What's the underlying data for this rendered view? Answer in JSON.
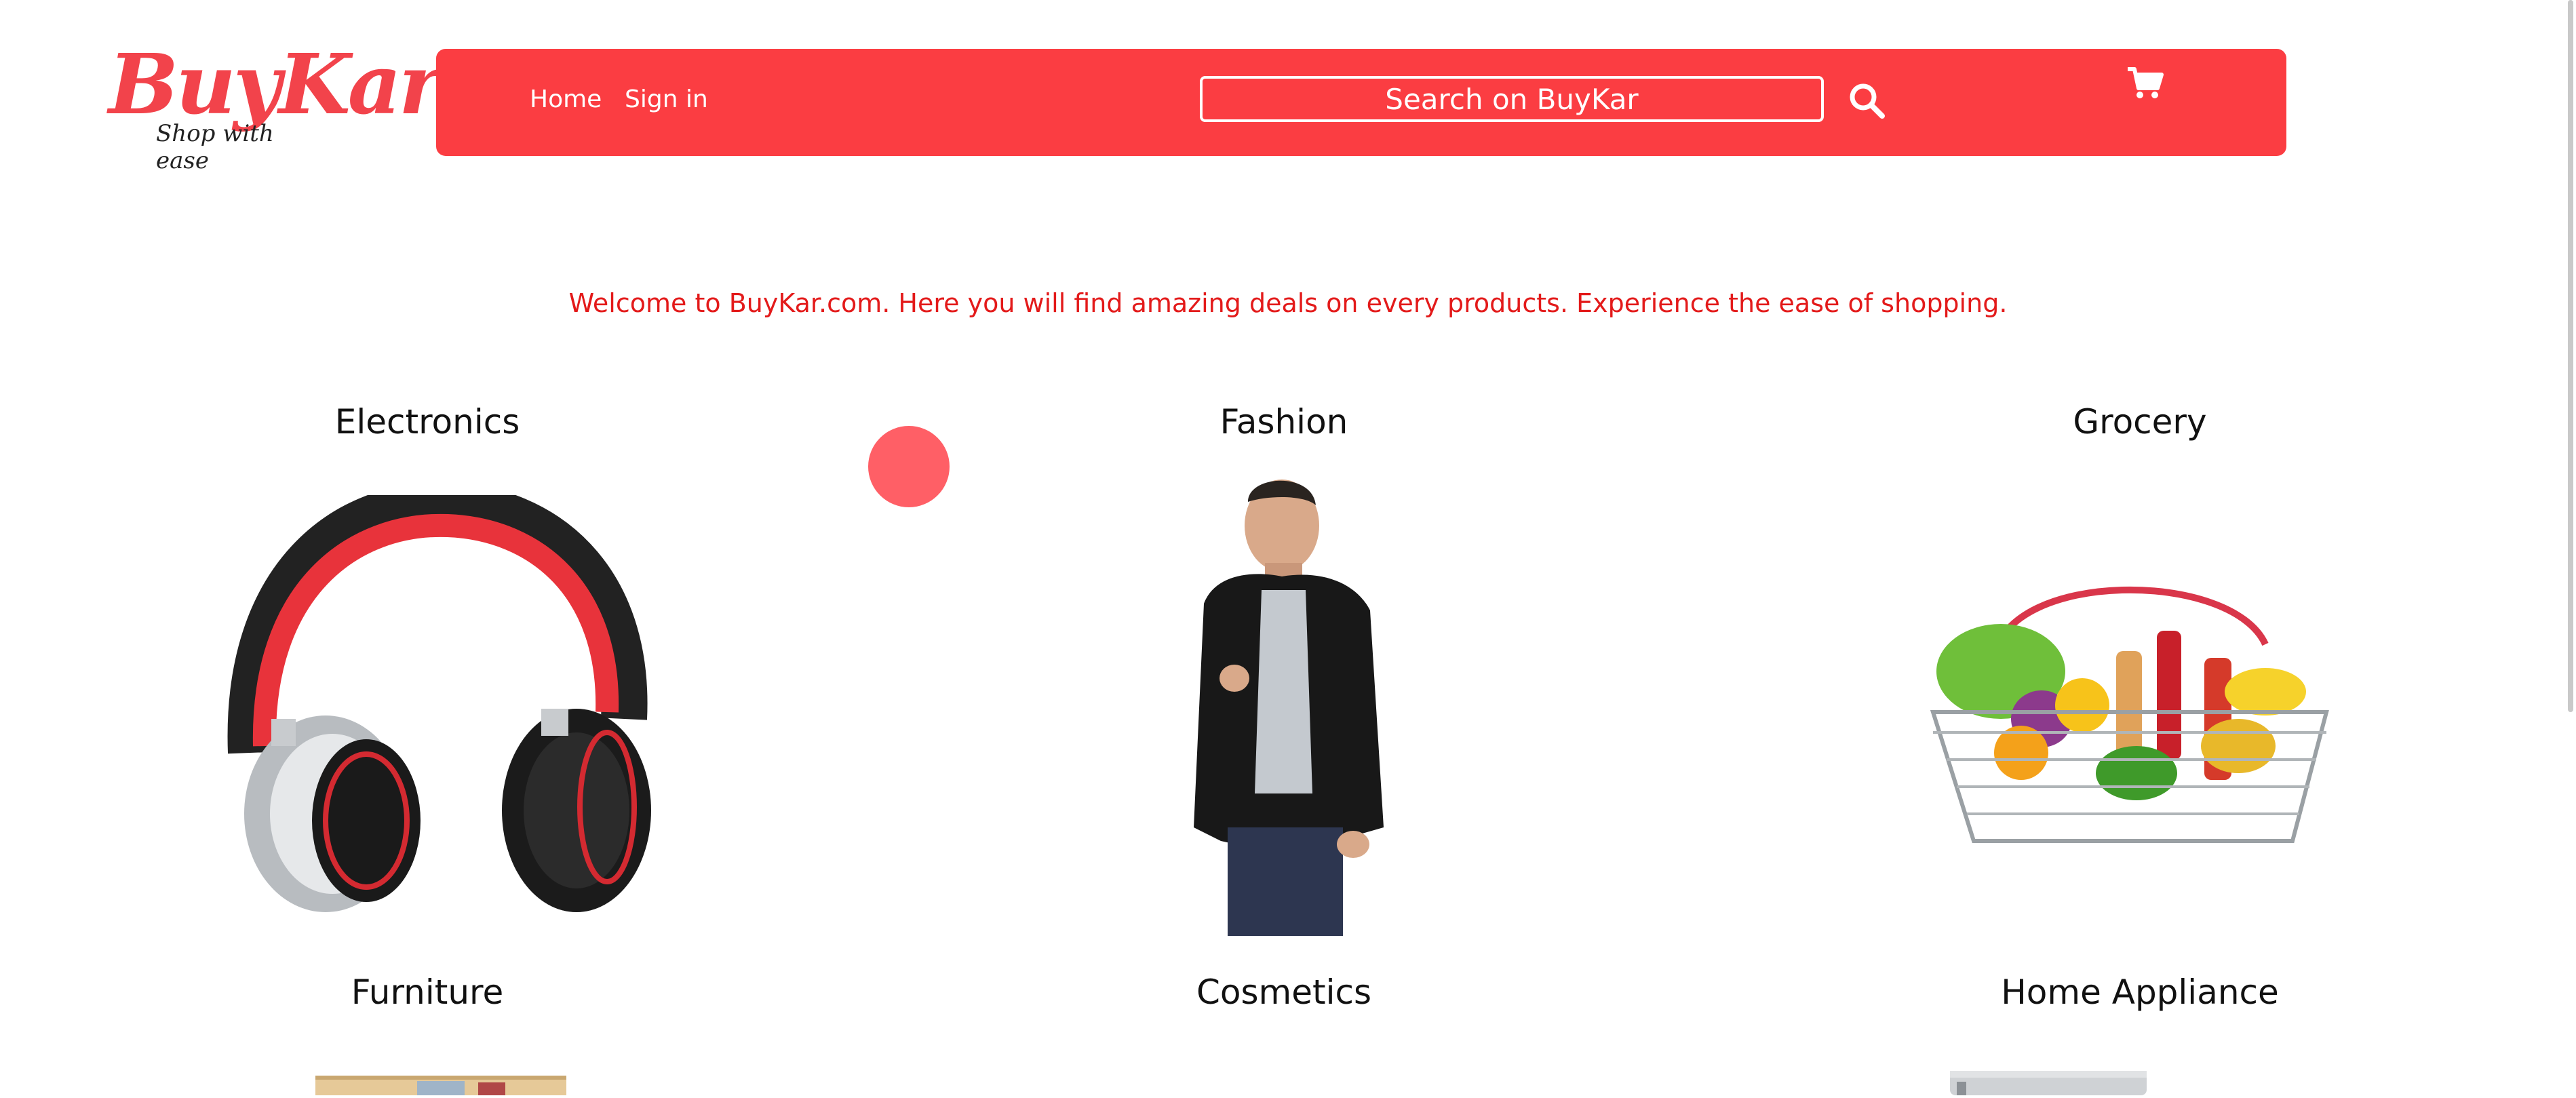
{
  "logo": {
    "brand": "BuyKar",
    "tagline": "Shop with ease"
  },
  "nav": {
    "home": "Home",
    "signin": "Sign in"
  },
  "search": {
    "label": "Search on BuyKar"
  },
  "welcome": "Welcome to BuyKar.com. Here you will find amazing deals on every products. Experience the ease of shopping.",
  "categories": [
    {
      "label": "Electronics"
    },
    {
      "label": "Fashion"
    },
    {
      "label": "Grocery"
    },
    {
      "label": "Furniture"
    },
    {
      "label": "Cosmetics"
    },
    {
      "label": "Home Appliance"
    }
  ],
  "colors": {
    "accent": "#fb3d42",
    "welcome": "#e31a1a",
    "indicator": "#ff5f66"
  },
  "icons": {
    "search": "search-icon",
    "cart": "cart-icon"
  }
}
